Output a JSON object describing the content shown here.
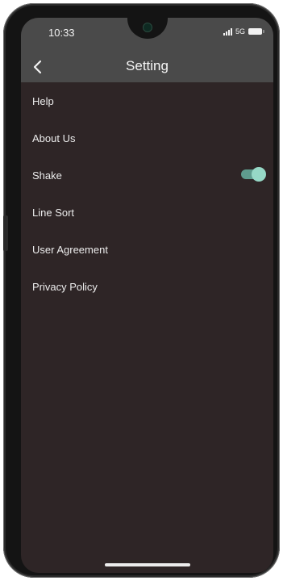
{
  "status_bar": {
    "time": "10:33",
    "network": "5G",
    "signal_icon": "signal-bars-icon",
    "battery_icon": "battery-icon"
  },
  "header": {
    "title": "Setting",
    "back_icon": "chevron-left-icon"
  },
  "menu": {
    "items": [
      {
        "label": "Help"
      },
      {
        "label": "About Us"
      },
      {
        "label": "Shake",
        "toggle_on": true
      },
      {
        "label": "Line Sort"
      },
      {
        "label": "User Agreement"
      },
      {
        "label": "Privacy Policy"
      }
    ]
  },
  "colors": {
    "background": "#2e2526",
    "header": "#4a4a4a",
    "toggle_track": "#5f9c8e",
    "toggle_knob": "#96d8c6",
    "text": "#ececec"
  }
}
